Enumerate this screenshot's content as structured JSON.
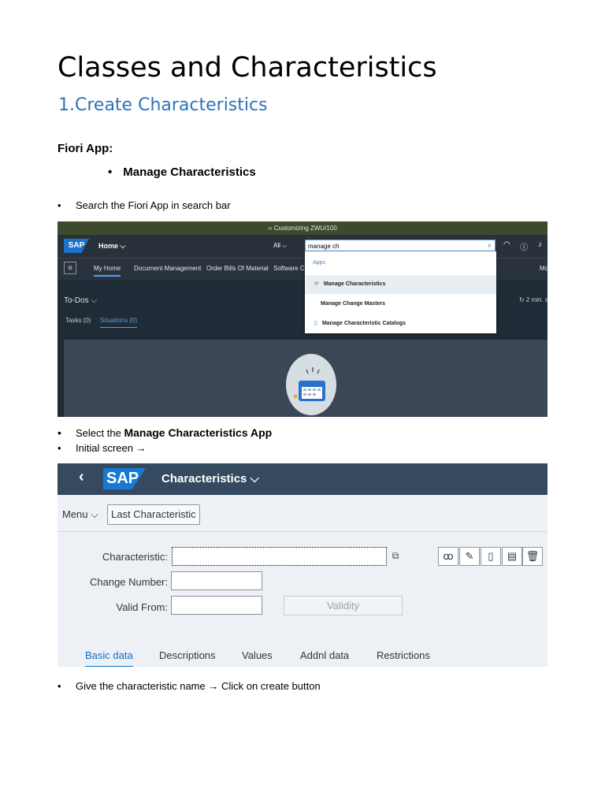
{
  "doc": {
    "title": "Classes and Characteristics",
    "heading": "1.Create Characteristics",
    "fiori_label": "Fiori App:",
    "sub_bullet": "Manage Characteristics",
    "bullet_dot": "•",
    "step1": "Search the Fiori App in search bar",
    "step2_prefix": "Select the ",
    "step2_bold": "Manage Characteristics App",
    "step3": "Initial screen →",
    "step4": "Give the characteristic name → Click on create button"
  },
  "shot1": {
    "system_title": "‹› Customizing ZWU/100",
    "logo": "SAP",
    "home": "Home ⌵",
    "scope": "All ⌵",
    "search_value": "manage ch",
    "nav": [
      "My Home",
      "Document Management",
      "Order Bills Of Material",
      "Software Co",
      "Mo"
    ],
    "todos": "To-Dos ⌵",
    "tasks": "Tasks (0)",
    "situations": "Situations (0)",
    "refresh": "↻ 2 min. a",
    "dropdown": {
      "header": "Apps",
      "items": [
        "Manage Characteristics",
        "Manage Change Masters",
        "Manage Characteristic Catalogs"
      ]
    }
  },
  "shot2": {
    "back": "‹",
    "logo": "SAP",
    "title": "Characteristics ⌵",
    "menu": "Menu ⌵",
    "last_characteristic": "Last Characteristic",
    "labels": {
      "characteristic": "Characteristic:",
      "change_number": "Change Number:",
      "valid_from": "Valid From:"
    },
    "validity": "Validity",
    "tabs": [
      "Basic data",
      "Descriptions",
      "Values",
      "Addnl data",
      "Restrictions"
    ]
  }
}
